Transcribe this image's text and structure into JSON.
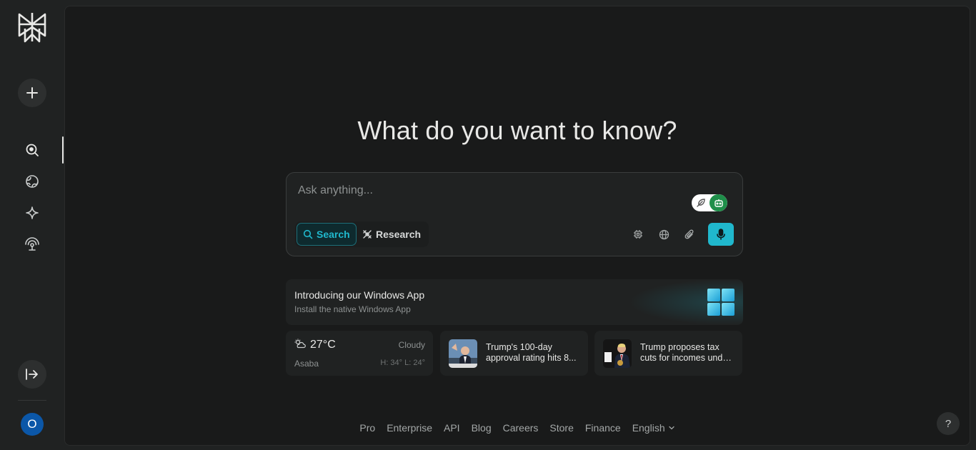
{
  "sidebar": {
    "logo_icon": "perplexity-logo-icon",
    "new_thread_icon": "plus-icon",
    "nav_items": [
      {
        "name": "home",
        "icon": "search-icon",
        "active": true
      },
      {
        "name": "discover",
        "icon": "globe-icon",
        "active": false
      },
      {
        "name": "spaces",
        "icon": "sparkle-icon",
        "active": false
      },
      {
        "name": "library",
        "icon": "broadcast-icon",
        "active": false
      }
    ],
    "expand_icon": "expand-arrow-icon",
    "avatar_initial": "O"
  },
  "main": {
    "title": "What do you want to know?",
    "search": {
      "placeholder": "Ask anything...",
      "modes": {
        "search_label": "Search",
        "research_label": "Research"
      },
      "tools": [
        "chip-icon",
        "globe-icon",
        "paperclip-icon"
      ],
      "mic_icon": "microphone-icon"
    },
    "promo": {
      "title": "Introducing our Windows App",
      "subtitle": "Install the native Windows App",
      "icon": "windows-logo-icon"
    },
    "weather": {
      "temp": "27°C",
      "condition": "Cloudy",
      "city": "Asaba",
      "high_low": "H: 34° L: 24°",
      "icon": "cloudy-sun-icon"
    },
    "news": [
      {
        "line1": "Trump's 100-day",
        "line2": "approval rating hits 8..."
      },
      {
        "line1": "Trump proposes tax",
        "line2": "cuts for incomes unde..."
      }
    ]
  },
  "footer": {
    "links": [
      "Pro",
      "Enterprise",
      "API",
      "Blog",
      "Careers",
      "Store",
      "Finance"
    ],
    "language": "English"
  },
  "help_label": "?",
  "colors": {
    "accent": "#20b8cd",
    "background": "#191a1a",
    "sidebar": "#202222",
    "avatar": "#0b57a8"
  }
}
